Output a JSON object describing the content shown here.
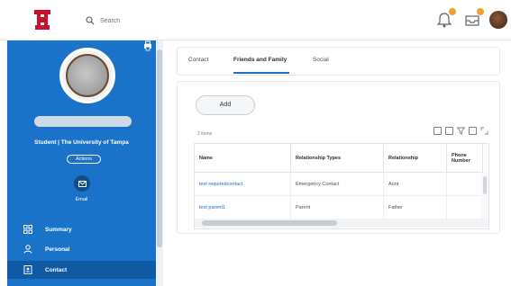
{
  "header": {
    "search_placeholder": "Search",
    "brand_color": "#c8102e",
    "badge_color": "#f0a030"
  },
  "sidebar": {
    "background": "#1a73c8",
    "subtitle": "Student | The University of Tampa",
    "actions_label": "Actions",
    "email_label": "Email",
    "items": [
      {
        "label": "Summary",
        "icon": "grid-icon"
      },
      {
        "label": "Personal",
        "icon": "person-icon"
      },
      {
        "label": "Contact",
        "icon": "contact-card-icon",
        "active": true
      }
    ]
  },
  "tabs": [
    {
      "label": "Contact"
    },
    {
      "label": "Friends and Family",
      "active": true
    },
    {
      "label": "Social"
    }
  ],
  "content": {
    "add_label": "Add",
    "items_count": "2 items",
    "table": {
      "columns": [
        "Name",
        "Relationship Types",
        "Relationship",
        "Phone Number"
      ],
      "rows": [
        [
          "test requiredcontact",
          "Emergency Contact",
          "Aunt",
          ""
        ],
        [
          "test parent1",
          "Parent",
          "Father",
          ""
        ]
      ]
    }
  }
}
